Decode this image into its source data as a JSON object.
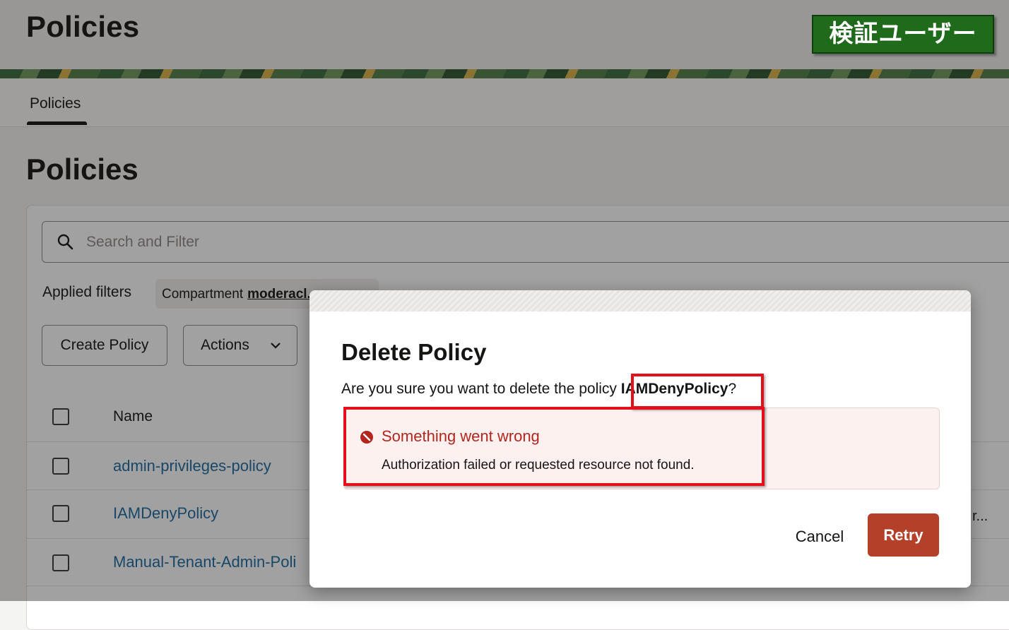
{
  "header": {
    "title": "Policies"
  },
  "user_badge": {
    "label": "検証ユーザー"
  },
  "tabs": [
    {
      "label": "Policies",
      "active": true
    }
  ],
  "section": {
    "title": "Policies"
  },
  "search": {
    "placeholder": "Search and Filter",
    "value": ""
  },
  "filters": {
    "label": "Applied filters",
    "chip_key": "Compartment",
    "chip_value": "moderacl..."
  },
  "toolbar": {
    "create_label": "Create Policy",
    "actions_label": "Actions"
  },
  "table": {
    "columns": [
      "Name"
    ],
    "rows": [
      {
        "name": "admin-privileges-policy"
      },
      {
        "name": "IAMDenyPolicy",
        "tail": "r..."
      },
      {
        "name": "Manual-Tenant-Admin-Poli"
      }
    ]
  },
  "modal": {
    "title": "Delete Policy",
    "question_prefix": "Are you sure you want to delete the policy ",
    "policy_name": "IAMDenyPolicy",
    "question_suffix": "?",
    "error_title": "Something went wrong",
    "error_detail": "Authorization failed or requested resource not found.",
    "cancel_label": "Cancel",
    "retry_label": "Retry"
  },
  "colors": {
    "link": "#1a6aa1",
    "error": "#b3261e",
    "retry_button": "#b5402a",
    "badge": "#1f6a1b",
    "annotation": "#e3101b"
  }
}
